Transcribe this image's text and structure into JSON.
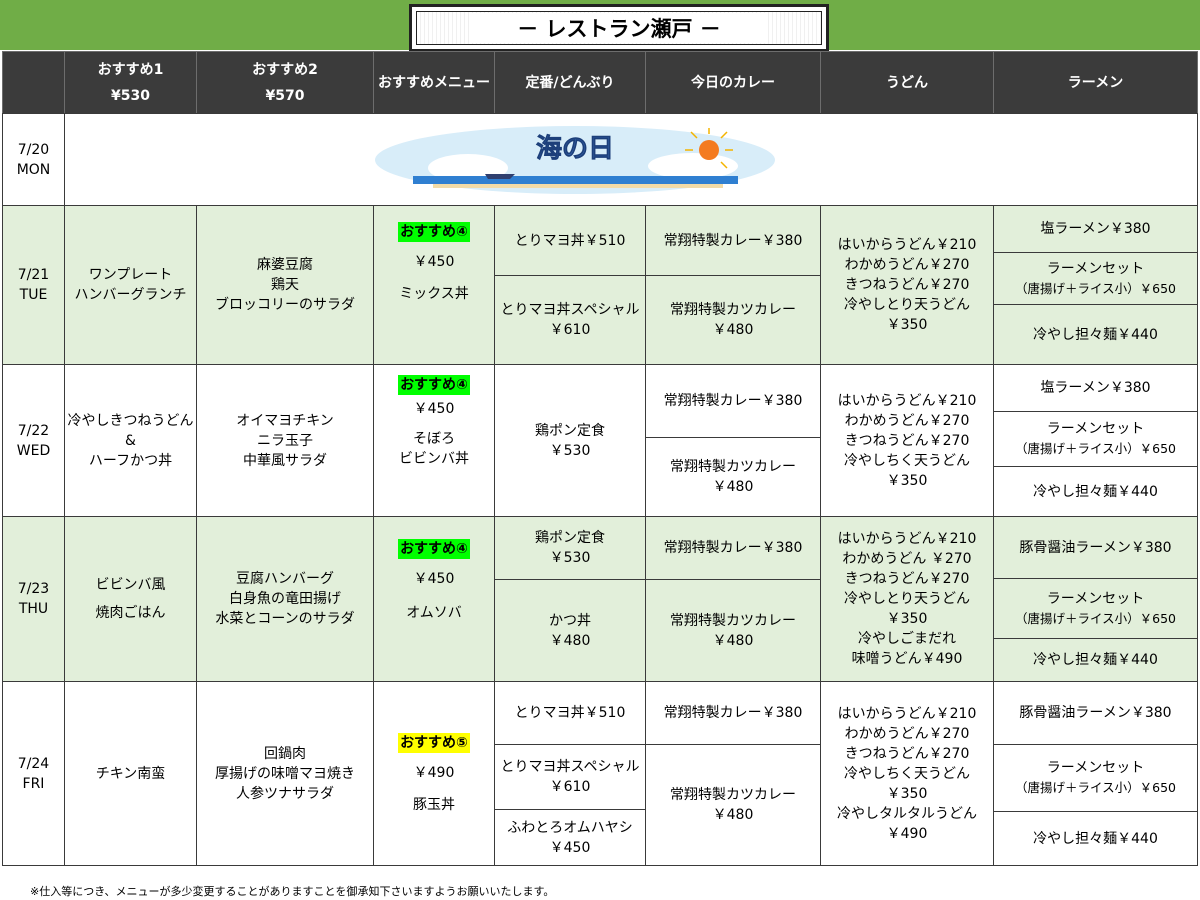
{
  "title": "－ レストラン瀬戸 －",
  "headers": {
    "col1": "おすすめ1",
    "col1_price": "¥530",
    "col2": "おすすめ2",
    "col2_price": "¥570",
    "col3": "おすすめメニュー",
    "col4": "定番/どんぶり",
    "col5": "今日のカレー",
    "col6": "うどん",
    "col7": "ラーメン"
  },
  "days": {
    "mon": {
      "date": "7/20",
      "dow": "MON",
      "holiday_text": "海の日"
    },
    "tue": {
      "date": "7/21",
      "dow": "TUE",
      "rec1": [
        "ワンプレート",
        "ハンバーグランチ"
      ],
      "rec2": [
        "麻婆豆腐",
        "鶏天",
        "ブロッコリーのサラダ"
      ],
      "menu_tag": "おすすめ④",
      "menu_price": "￥450",
      "menu_name": "ミックス丼",
      "teiban": [
        "とりマヨ丼￥510",
        "とりマヨ丼スペシャル",
        "￥610"
      ],
      "curry": [
        "常翔特製カレー￥380",
        "常翔特製カツカレー",
        "￥480"
      ],
      "udon": [
        "はいからうどん￥210",
        "わかめうどん￥270",
        "きつねうどん￥270",
        "冷やしとり天うどん",
        "￥350"
      ],
      "ramen": [
        "塩ラーメン￥380",
        "ラーメンセット",
        "（唐揚げ＋ライス小）￥650",
        "冷やし担々麺￥440"
      ]
    },
    "wed": {
      "date": "7/22",
      "dow": "WED",
      "rec1": [
        "冷やしきつねうどん",
        "&",
        "ハーフかつ丼"
      ],
      "rec2": [
        "オイマヨチキン",
        "ニラ玉子",
        "中華風サラダ"
      ],
      "menu_tag": "おすすめ④",
      "menu_price": "￥450",
      "menu_name1": "そぼろ",
      "menu_name2": "ビビンバ丼",
      "teiban": [
        "鶏ポン定食",
        "￥530"
      ],
      "curry": [
        "常翔特製カレー￥380",
        "常翔特製カツカレー",
        "￥480"
      ],
      "udon": [
        "はいからうどん￥210",
        "わかめうどん￥270",
        "きつねうどん￥270",
        "冷やしちく天うどん",
        "￥350"
      ],
      "ramen": [
        "塩ラーメン￥380",
        "ラーメンセット",
        "（唐揚げ＋ライス小）￥650",
        "冷やし担々麺￥440"
      ]
    },
    "thu": {
      "date": "7/23",
      "dow": "THU",
      "rec1": [
        "ビビンバ風",
        "焼肉ごはん"
      ],
      "rec2": [
        "豆腐ハンバーグ",
        "白身魚の竜田揚げ",
        "水菜とコーンのサラダ"
      ],
      "menu_tag": "おすすめ④",
      "menu_price": "￥450",
      "menu_name": "オムソバ",
      "teiban": [
        "鶏ポン定食",
        "￥530",
        "かつ丼",
        "￥480"
      ],
      "curry": [
        "常翔特製カレー￥380",
        "常翔特製カツカレー",
        "￥480"
      ],
      "udon": [
        "はいからうどん￥210",
        "わかめうどん ￥270",
        "きつねうどん￥270",
        "冷やしとり天うどん",
        "￥350",
        "冷やしごまだれ",
        "味噌うどん￥490"
      ],
      "ramen": [
        "豚骨醤油ラーメン￥380",
        "ラーメンセット",
        "（唐揚げ＋ライス小）￥650",
        "冷やし担々麺￥440"
      ]
    },
    "fri": {
      "date": "7/24",
      "dow": "FRI",
      "rec1": [
        "チキン南蛮"
      ],
      "rec2": [
        "回鍋肉",
        "厚揚げの味噌マヨ焼き",
        "人参ツナサラダ"
      ],
      "menu_tag": "おすすめ⑤",
      "menu_price": "￥490",
      "menu_name": "豚玉丼",
      "teiban": [
        "とりマヨ丼￥510",
        "とりマヨ丼スペシャル",
        "￥610",
        "ふわとろオムハヤシ",
        "￥450"
      ],
      "curry": [
        "常翔特製カレー￥380",
        "常翔特製カツカレー",
        "￥480"
      ],
      "udon": [
        "はいからうどん￥210",
        "わかめうどん￥270",
        "きつねうどん￥270",
        "冷やしちく天うどん",
        "￥350",
        "冷やしタルタルうどん",
        "￥490"
      ],
      "ramen": [
        "豚骨醤油ラーメン￥380",
        "ラーメンセット",
        "（唐揚げ＋ライス小）￥650",
        "冷やし担々麺￥440"
      ]
    }
  },
  "footnote": "※仕入等につき、メニューが多少変更することがありますことを御承知下さいますようお願いいたします。",
  "colors": {
    "band": "#70ad47",
    "header": "#3b3b3b",
    "row_green": "#e2efda",
    "tag_green": "#00ff00",
    "tag_yellow": "#ffff00"
  }
}
